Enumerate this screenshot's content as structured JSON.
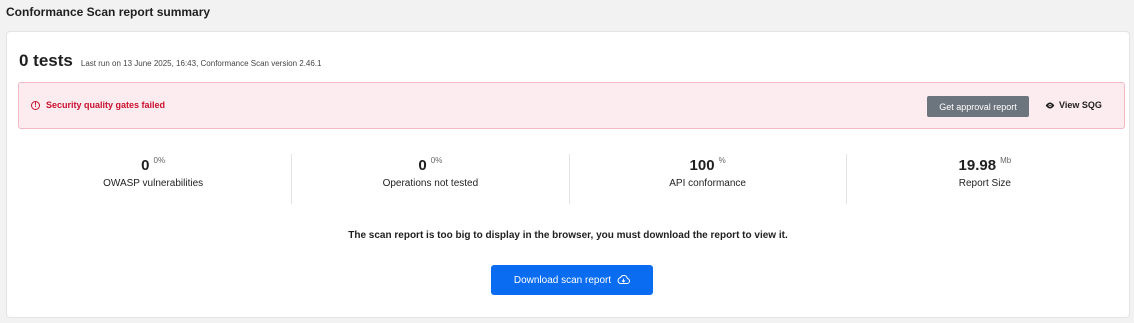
{
  "page": {
    "title": "Conformance Scan report summary"
  },
  "summary": {
    "tests_count": "0 tests",
    "last_run": "Last run on 13 June 2025, 16:43, Conformance Scan version 2.46.1"
  },
  "alert": {
    "icon": "exclamation-circle-icon",
    "message": "Security quality gates failed",
    "approval_button": "Get approval report",
    "view_sqg": "View SQG",
    "colors": {
      "text": "#c8102e",
      "background": "#fdecef",
      "border": "#f4b8c3"
    }
  },
  "stats": [
    {
      "value": "0",
      "unit": "0%",
      "label": "OWASP vulnerabilities"
    },
    {
      "value": "0",
      "unit": "0%",
      "label": "Operations not tested"
    },
    {
      "value": "100",
      "unit": "%",
      "label": "API conformance"
    },
    {
      "value": "19.98",
      "unit": "Mb",
      "label": "Report Size"
    }
  ],
  "notice": "The scan report is too big to display in the browser, you must download the report to view it.",
  "download": {
    "label": "Download scan report",
    "icon": "cloud-download-icon",
    "color": "#0a6cf0"
  }
}
